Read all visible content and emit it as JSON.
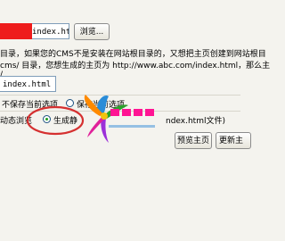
{
  "file_field": {
    "value": "index.htm"
  },
  "browse_button": {
    "label": "浏览..."
  },
  "description": {
    "line1": "目录，如果您的CMS不是安装在网站根目录的，又想把主页创建到网站根目",
    "line2": "cms/ 目录，您想生成的主页为 http://www.abc.com/index.html，那么主",
    "line3": "/"
  },
  "home_field": {
    "value": "index.html"
  },
  "options": {
    "no_save_label": "不保存当前选项",
    "save_label": "保存当前选项"
  },
  "mode": {
    "dynamic_label": "动态浏览",
    "generate_label": "生成静",
    "trailing_text": "ndex.html文件)"
  },
  "buttons": {
    "preview_label": "预览主页",
    "update_label": "更新主"
  },
  "colors": {
    "redacted_box": "#ee1c1c",
    "highlight_circle": "#d53030",
    "watermark_magenta": "#ff1493"
  }
}
